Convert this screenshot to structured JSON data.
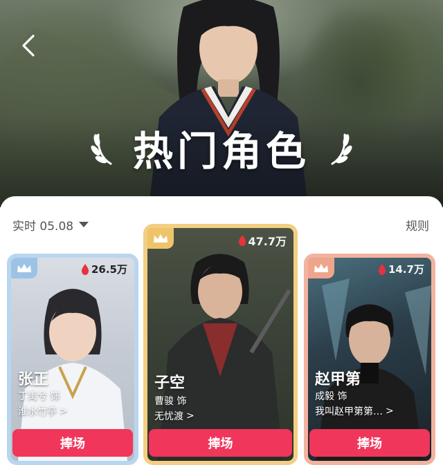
{
  "header": {
    "title": "热门角色"
  },
  "ranking": {
    "date_label": "实时 05.08",
    "rules_label": "规则"
  },
  "cards": [
    {
      "rank": 2,
      "heat": "26.5万",
      "character": "张正",
      "actor": "丁禹兮 饰",
      "work": "淮水竹亭",
      "button": "捧场",
      "accent": "#b9d6ef"
    },
    {
      "rank": 1,
      "heat": "47.7万",
      "character": "子空",
      "actor": "曹骏 饰",
      "work": "无忧渡",
      "button": "捧场",
      "accent": "#f2cf82"
    },
    {
      "rank": 3,
      "heat": "14.7万",
      "character": "赵甲第",
      "actor": "成毅 饰",
      "work": "我叫赵甲第第…",
      "button": "捧场",
      "accent": "#f1b39f"
    }
  ],
  "colors": {
    "button": "#f0365a",
    "heat_icon": "#e8323c"
  },
  "icons": {
    "back": "chevron-left-icon",
    "crown": "crown-icon",
    "heat": "flame-drop-icon",
    "laurel": "laurel-icon"
  }
}
